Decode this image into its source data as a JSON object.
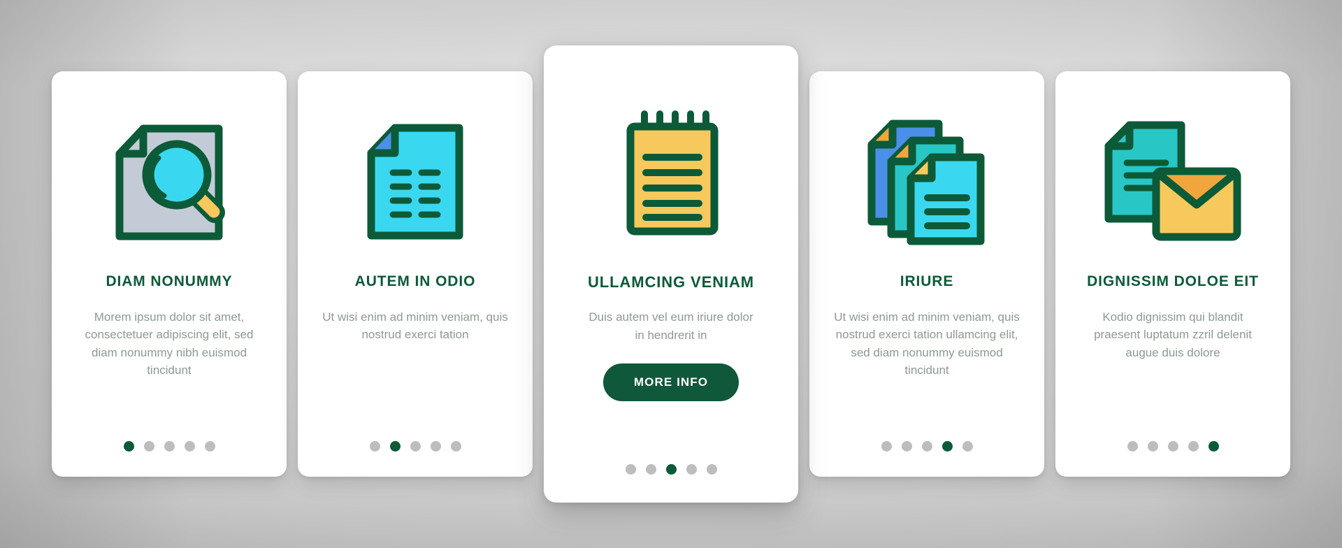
{
  "theme": {
    "accent_green": "#0c5a38",
    "button_green": "#10583a",
    "body_text": "#8c9b90",
    "dot_inactive": "#bdbdbd",
    "card_background": "#ffffff",
    "page_background": "#cfcfcf",
    "icon_stroke": "#0c5a38",
    "icon_cyan": "#3ad8f0",
    "icon_yellow": "#f7c85c",
    "icon_blue": "#4a90e8",
    "icon_teal": "#29c6c6",
    "icon_gray_blue": "#c3ccd6",
    "icon_orange": "#f0a63c"
  },
  "total_dots": 5,
  "cards": [
    {
      "icon_name": "document-search-icon",
      "title": "DIAM NONUMMY",
      "body": "Morem ipsum dolor sit amet, consectetuer adipiscing elit, sed diam nonummy nibh euismod tincidunt",
      "active_dot": 1,
      "has_button": false,
      "button_label": ""
    },
    {
      "icon_name": "document-text-icon",
      "title": "AUTEM IN ODIO",
      "body": "Ut wisi enim ad minim veniam, quis nostrud exerci tation",
      "active_dot": 2,
      "has_button": false,
      "button_label": ""
    },
    {
      "icon_name": "notepad-icon",
      "title": "ULLAMCING VENIAM",
      "body": "Duis autem vel eum iriure dolor in hendrerit in",
      "active_dot": 3,
      "has_button": true,
      "button_label": "MORE INFO"
    },
    {
      "icon_name": "stacked-documents-icon",
      "title": "IRIURE",
      "body": "Ut wisi enim ad minim veniam, quis nostrud exerci tation ullamcing elit, sed diam nonummy euismod tincidunt",
      "active_dot": 4,
      "has_button": false,
      "button_label": ""
    },
    {
      "icon_name": "document-envelope-icon",
      "title": "DIGNISSIM DOLOE EIT",
      "body": "Kodio dignissim qui blandit praesent luptatum zzril delenit augue duis dolore",
      "active_dot": 5,
      "has_button": false,
      "button_label": ""
    }
  ]
}
